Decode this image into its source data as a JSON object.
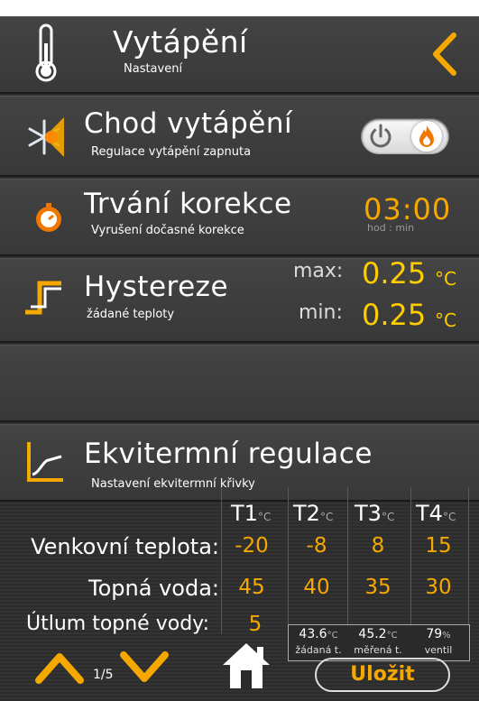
{
  "header": {
    "title": "Vytápění",
    "subtitle": "Nastavení"
  },
  "heating": {
    "title": "Chod vytápění",
    "subtitle": "Regulace vytápění zapnuta",
    "toggle_on": true
  },
  "correction": {
    "title": "Trvání korekce",
    "subtitle": "Vyrušení dočasné korekce",
    "value": "03:00",
    "unit": "hod : min"
  },
  "hysteresis": {
    "title": "Hystereze",
    "subtitle": "žádané teploty",
    "max_label": "max:",
    "max_value": "0.25",
    "min_label": "min:",
    "min_value": "0.25",
    "unit": "°C"
  },
  "equitherm": {
    "title": "Ekvitermní regulace",
    "subtitle": "Nastavení ekvitermní křivky"
  },
  "table": {
    "headers": [
      {
        "label": "T1",
        "unit": "°C"
      },
      {
        "label": "T2",
        "unit": "°C"
      },
      {
        "label": "T3",
        "unit": "°C"
      },
      {
        "label": "T4",
        "unit": "°C"
      }
    ],
    "rows": [
      {
        "label": "Venkovní teplota:",
        "values": [
          "-20",
          "-8",
          "8",
          "15"
        ]
      },
      {
        "label": "Topná voda:",
        "values": [
          "45",
          "40",
          "35",
          "30"
        ]
      }
    ],
    "attenuation_label": "Útlum topné vody:",
    "attenuation_value": "5"
  },
  "info": [
    {
      "value": "43.6",
      "unit": "°C",
      "label": "žádaná t."
    },
    {
      "value": "45.2",
      "unit": "°C",
      "label": "měřená t."
    },
    {
      "value": "79",
      "unit": "%",
      "label": "ventil"
    }
  ],
  "footer": {
    "page": "1/5",
    "save_label": "Uložit"
  },
  "colors": {
    "accent": "#f5a800",
    "value": "#ffcc00",
    "background": "#2c2c2c"
  }
}
